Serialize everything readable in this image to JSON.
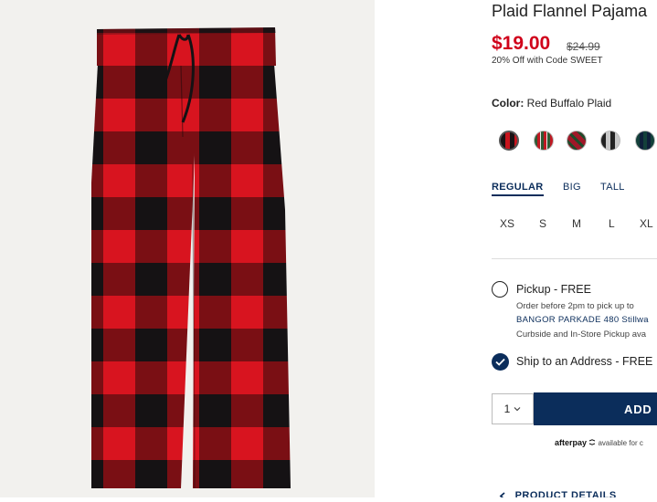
{
  "product": {
    "title": "Plaid Flannel Pajama",
    "price": "$19.00",
    "was_price": "$24.99",
    "promo": "20% Off with Code SWEET"
  },
  "color": {
    "label": "Color:",
    "value": "Red Buffalo Plaid",
    "swatches": [
      {
        "name": "red-buffalo-plaid",
        "color": "#b8141c"
      },
      {
        "name": "green-red-tartan",
        "color": "#3a5e3a"
      },
      {
        "name": "red-green-plaid",
        "color": "#a01828"
      },
      {
        "name": "gray-black-buffalo",
        "color": "#8a8a8a"
      },
      {
        "name": "green-navy-tartan",
        "color": "#13403a"
      }
    ]
  },
  "fit": {
    "tabs": [
      "REGULAR",
      "BIG",
      "TALL"
    ],
    "active": "REGULAR"
  },
  "sizes": [
    "XS",
    "S",
    "M",
    "L",
    "XL"
  ],
  "fulfillment": {
    "pickup_label": "Pickup - FREE",
    "pickup_note": "Order before 2pm to pick up to",
    "store_name": "BANGOR PARKADE 480 Stillwa",
    "curbside_note": "Curbside and In-Store Pickup ava",
    "ship_label": "Ship to an Address - FREE"
  },
  "cart": {
    "quantity": "1",
    "add_label": "ADD"
  },
  "afterpay": {
    "brand": "afterpay",
    "text": "available for c"
  },
  "details_label": "PRODUCT DETAILS",
  "colors": {
    "accent": "#0b2d5b",
    "sale": "#d0021b"
  }
}
